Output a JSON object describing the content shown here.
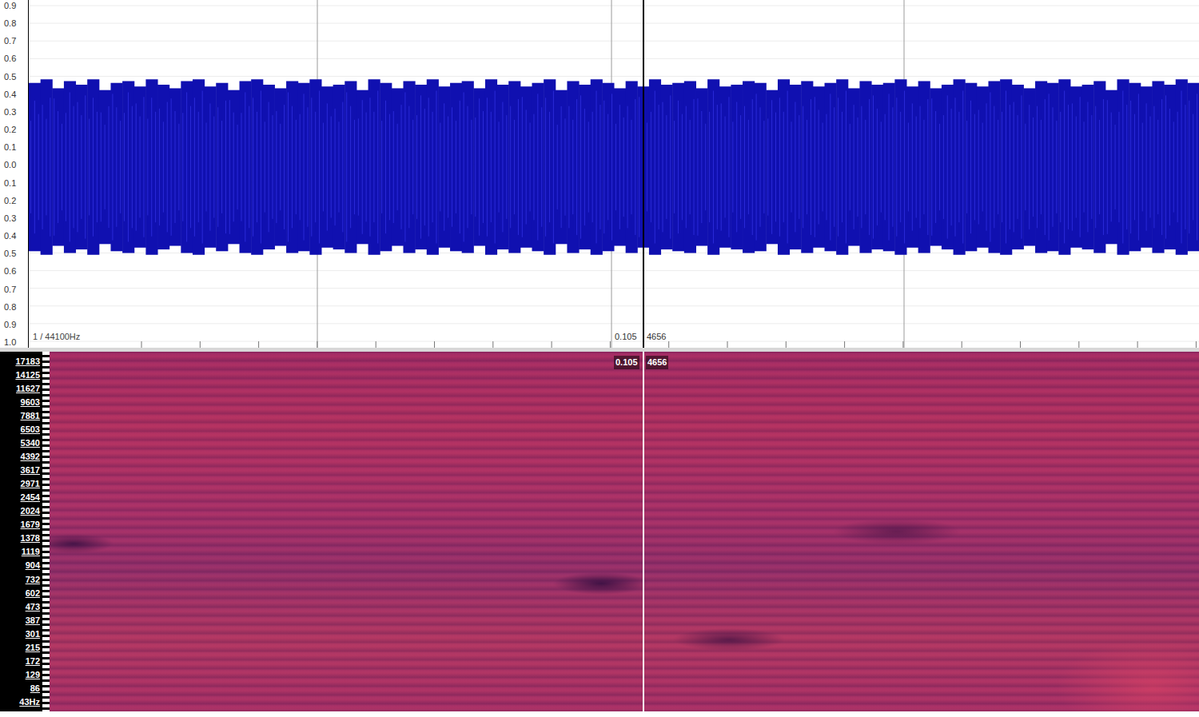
{
  "waveform": {
    "y_axis_ticks": [
      "0.9",
      "0.8",
      "0.7",
      "0.6",
      "0.5",
      "0.4",
      "0.3",
      "0.2",
      "0.1",
      "0.0",
      "0.1",
      "0.2",
      "0.3",
      "0.4",
      "0.5",
      "0.6",
      "0.7",
      "0.8",
      "0.9",
      "1.0"
    ],
    "sample_rate_label": "1 / 44100Hz",
    "cursor": {
      "time": "0.105",
      "sample": "4656"
    },
    "peaks": [
      0.47,
      0.49,
      0.44,
      0.48,
      0.46,
      0.49,
      0.43,
      0.47,
      0.48,
      0.45,
      0.49,
      0.46,
      0.44,
      0.48,
      0.49,
      0.45,
      0.47,
      0.43,
      0.48,
      0.49,
      0.46,
      0.44,
      0.48,
      0.47,
      0.49,
      0.45,
      0.46,
      0.48,
      0.43,
      0.49,
      0.47,
      0.44,
      0.48,
      0.46,
      0.49,
      0.45,
      0.47,
      0.48,
      0.44,
      0.49,
      0.46,
      0.48,
      0.45,
      0.47,
      0.49,
      0.43,
      0.48,
      0.46,
      0.49,
      0.47,
      0.44,
      0.48,
      0.45,
      0.49,
      0.46,
      0.47,
      0.48,
      0.44,
      0.49,
      0.45,
      0.46,
      0.48,
      0.47,
      0.43,
      0.49,
      0.46,
      0.48,
      0.45,
      0.47,
      0.49,
      0.44,
      0.48,
      0.46,
      0.47,
      0.49,
      0.45,
      0.48,
      0.44,
      0.46,
      0.49,
      0.47,
      0.45,
      0.48,
      0.49,
      0.46,
      0.44,
      0.48,
      0.47,
      0.49,
      0.45,
      0.46,
      0.48,
      0.43,
      0.49,
      0.47,
      0.45,
      0.48,
      0.46,
      0.49,
      0.47
    ]
  },
  "spectrogram": {
    "frequency_ticks": [
      "17183",
      "14125",
      "11627",
      "9603",
      "7881",
      "6503",
      "5340",
      "4392",
      "3617",
      "2971",
      "2454",
      "2024",
      "1679",
      "1378",
      "1119",
      "904",
      "732",
      "602",
      "473",
      "387",
      "301",
      "215",
      "172",
      "129",
      "86",
      "43Hz"
    ],
    "cursor": {
      "time": "0.105",
      "sample": "4656"
    }
  }
}
